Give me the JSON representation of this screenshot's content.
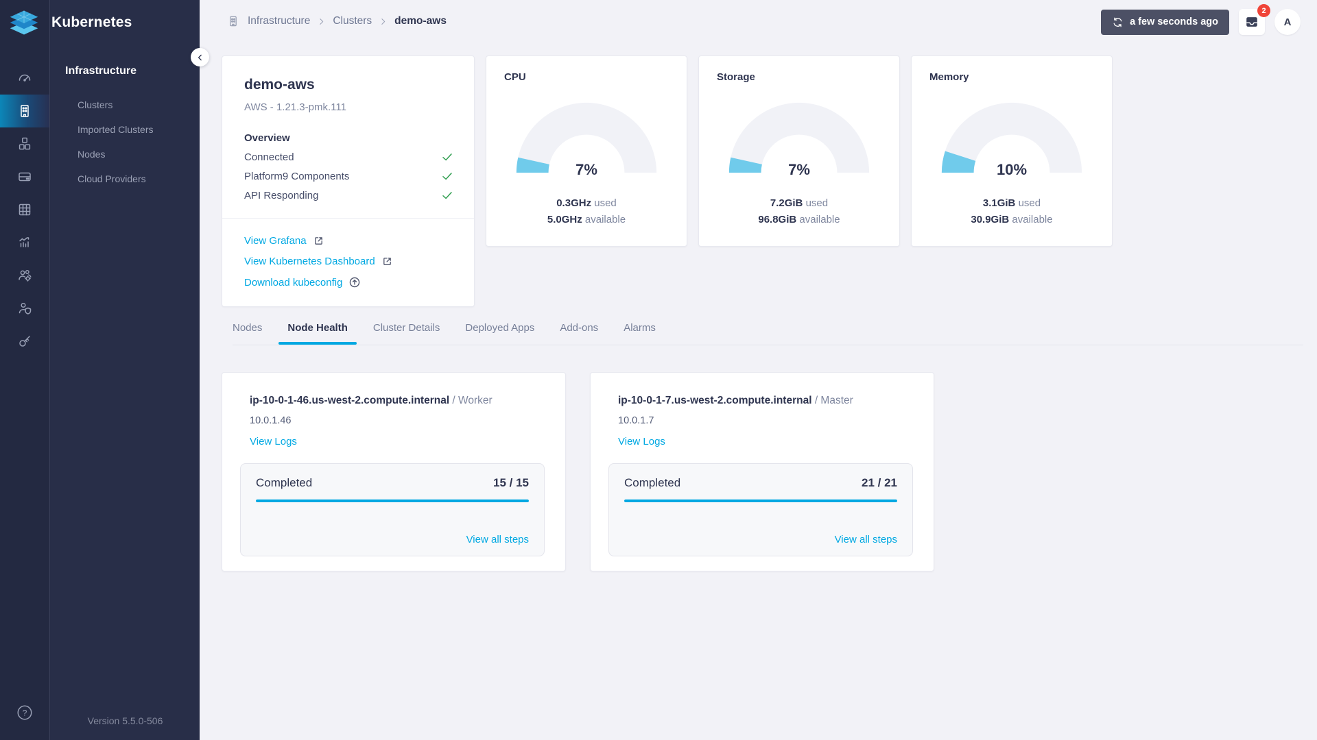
{
  "app": {
    "title": "Kubernetes",
    "version": "Version 5.5.0-506"
  },
  "topbar": {
    "refresh_label": "a few seconds ago",
    "notification_count": "2",
    "avatar_initial": "A"
  },
  "breadcrumb": {
    "items": [
      "Infrastructure",
      "Clusters",
      "demo-aws"
    ],
    "icon": "building-icon"
  },
  "sidebar": {
    "rail_icons": [
      "dashboard-icon",
      "infrastructure-icon",
      "app-catalog-icon",
      "storage-icon",
      "apps-icon",
      "monitoring-icon",
      "tenants-icon",
      "access-control-icon",
      "api-access-icon",
      "help-icon"
    ],
    "active_rail_icon": "infrastructure-icon",
    "section_title": "Infrastructure",
    "items": [
      {
        "label": "Clusters"
      },
      {
        "label": "Imported Clusters"
      },
      {
        "label": "Nodes"
      },
      {
        "label": "Cloud Providers"
      }
    ]
  },
  "cluster_card": {
    "name": "demo-aws",
    "subtitle": "AWS - 1.21.3-pmk.111",
    "overview_title": "Overview",
    "checks": [
      {
        "label": "Connected",
        "status": "ok"
      },
      {
        "label": "Platform9 Components",
        "status": "ok"
      },
      {
        "label": "API Responding",
        "status": "ok"
      }
    ],
    "links": [
      {
        "label": "View Grafana",
        "icon": "external-link-icon"
      },
      {
        "label": "View Kubernetes Dashboard",
        "icon": "external-link-icon"
      },
      {
        "label": "Download kubeconfig",
        "icon": "upload-circle-icon"
      }
    ]
  },
  "gauges": [
    {
      "title": "CPU",
      "percent": 7,
      "percent_label": "7%",
      "used_value": "0.3GHz",
      "used_label": " used",
      "available_value": "5.0GHz",
      "available_label": " available"
    },
    {
      "title": "Storage",
      "percent": 7,
      "percent_label": "7%",
      "used_value": "7.2GiB",
      "used_label": " used",
      "available_value": "96.8GiB",
      "available_label": " available"
    },
    {
      "title": "Memory",
      "percent": 10,
      "percent_label": "10%",
      "used_value": "3.1GiB",
      "used_label": " used",
      "available_value": "30.9GiB",
      "available_label": " available"
    }
  ],
  "tabs": {
    "items": [
      {
        "label": "Nodes",
        "active": false
      },
      {
        "label": "Node Health",
        "active": true
      },
      {
        "label": "Cluster Details",
        "active": false
      },
      {
        "label": "Deployed Apps",
        "active": false
      },
      {
        "label": "Add-ons",
        "active": false
      },
      {
        "label": "Alarms",
        "active": false
      }
    ]
  },
  "nodes": [
    {
      "hostname": "ip-10-0-1-46.us-west-2.compute.internal",
      "role_text": " / Worker",
      "ip": "10.0.1.46",
      "logs_label": "View Logs",
      "status_label": "Completed",
      "steps_count": "15 / 15",
      "progress_percent": 100,
      "all_steps_label": "View all steps"
    },
    {
      "hostname": "ip-10-0-1-7.us-west-2.compute.internal",
      "role_text": " / Master",
      "ip": "10.0.1.7",
      "logs_label": "View Logs",
      "status_label": "Completed",
      "steps_count": "21 / 21",
      "progress_percent": 100,
      "all_steps_label": "View all steps"
    }
  ],
  "colors": {
    "accent": "#00a8e2",
    "gauge_fill": "#70cbeb",
    "gauge_track": "#f1f2f7",
    "check_green": "#2f9e4f",
    "badge_red": "#f04438",
    "sidebar_bg": "#232941",
    "active_gradient_start": "#0c86b8"
  }
}
